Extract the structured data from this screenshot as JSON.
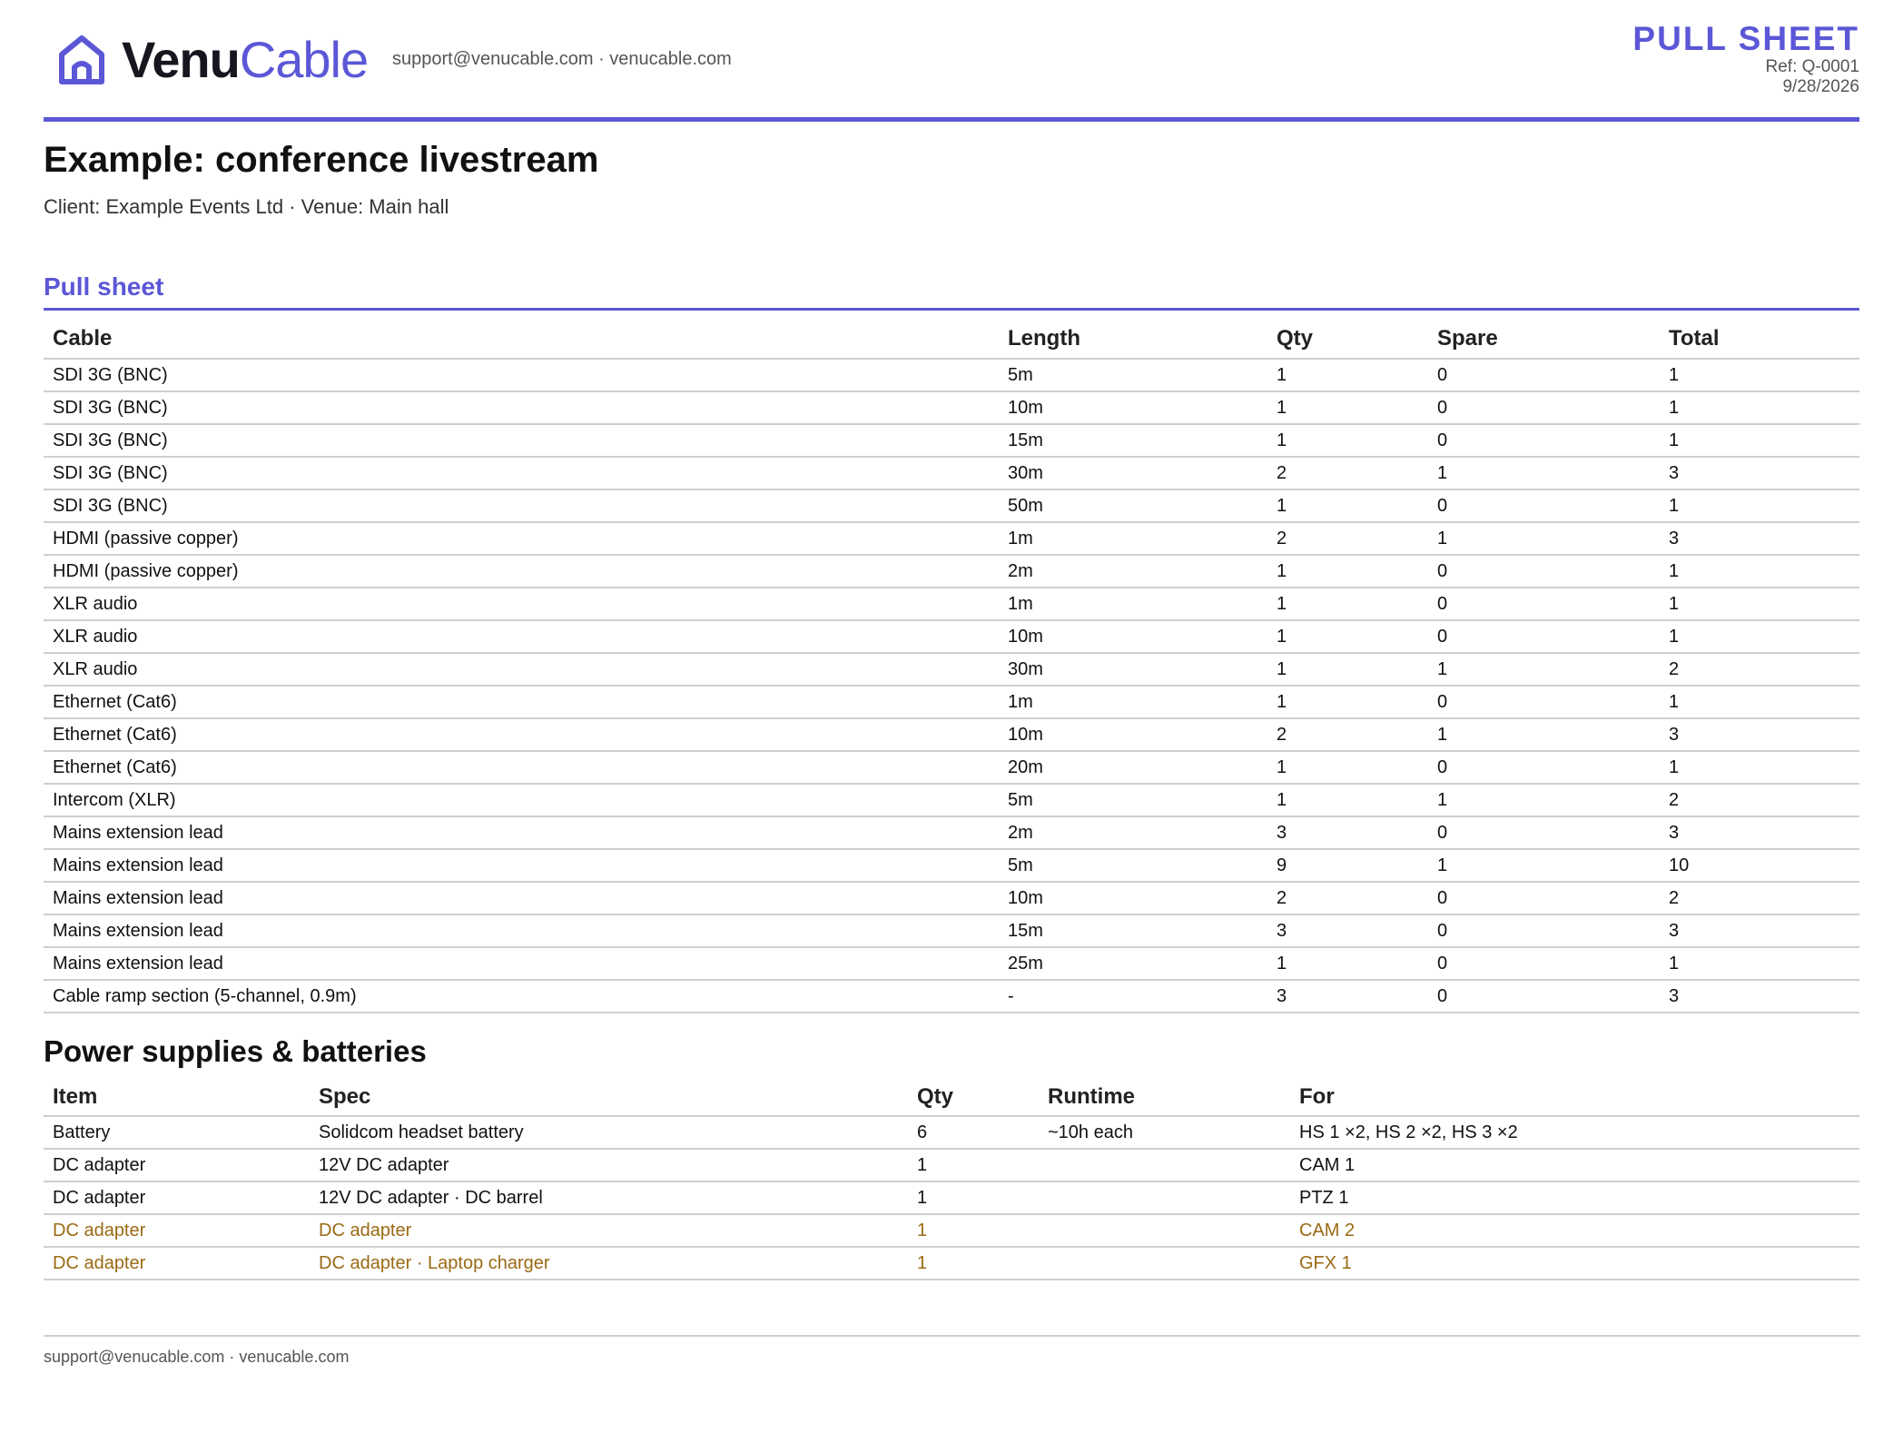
{
  "brand": {
    "name_part1": "Venu",
    "name_part2": "Cable",
    "icon": "house-icon",
    "accent": "#5b57d6"
  },
  "header": {
    "contact": "support@venucable.com · venucable.com",
    "doc_title": "PULL SHEET",
    "ref": "Ref: Q-0001",
    "date": "9/28/2026"
  },
  "project": {
    "title": "Example: conference livestream",
    "meta": "Client: Example Events Ltd · Venue: Main hall"
  },
  "pull_sheet": {
    "section_title": "Pull sheet",
    "columns": [
      "Cable",
      "Length",
      "Qty",
      "Spare",
      "Total"
    ],
    "rows": [
      [
        "SDI 3G (BNC)",
        "5m",
        "1",
        "0",
        "1"
      ],
      [
        "SDI 3G (BNC)",
        "10m",
        "1",
        "0",
        "1"
      ],
      [
        "SDI 3G (BNC)",
        "15m",
        "1",
        "0",
        "1"
      ],
      [
        "SDI 3G (BNC)",
        "30m",
        "2",
        "1",
        "3"
      ],
      [
        "SDI 3G (BNC)",
        "50m",
        "1",
        "0",
        "1"
      ],
      [
        "HDMI (passive copper)",
        "1m",
        "2",
        "1",
        "3"
      ],
      [
        "HDMI (passive copper)",
        "2m",
        "1",
        "0",
        "1"
      ],
      [
        "XLR audio",
        "1m",
        "1",
        "0",
        "1"
      ],
      [
        "XLR audio",
        "10m",
        "1",
        "0",
        "1"
      ],
      [
        "XLR audio",
        "30m",
        "1",
        "1",
        "2"
      ],
      [
        "Ethernet (Cat6)",
        "1m",
        "1",
        "0",
        "1"
      ],
      [
        "Ethernet (Cat6)",
        "10m",
        "2",
        "1",
        "3"
      ],
      [
        "Ethernet (Cat6)",
        "20m",
        "1",
        "0",
        "1"
      ],
      [
        "Intercom (XLR)",
        "5m",
        "1",
        "1",
        "2"
      ],
      [
        "Mains extension lead",
        "2m",
        "3",
        "0",
        "3"
      ],
      [
        "Mains extension lead",
        "5m",
        "9",
        "1",
        "10"
      ],
      [
        "Mains extension lead",
        "10m",
        "2",
        "0",
        "2"
      ],
      [
        "Mains extension lead",
        "15m",
        "3",
        "0",
        "3"
      ],
      [
        "Mains extension lead",
        "25m",
        "1",
        "0",
        "1"
      ],
      [
        "Cable ramp section (5-channel, 0.9m)",
        "-",
        "3",
        "0",
        "3"
      ]
    ]
  },
  "power": {
    "section_title": "Power supplies & batteries",
    "columns": [
      "Item",
      "Spec",
      "Qty",
      "Runtime",
      "For"
    ],
    "warn_color": "#9a6a14",
    "rows": [
      [
        "Battery",
        "Solidcom headset battery",
        "6",
        "~10h each",
        "HS 1 ×2, HS 2 ×2, HS 3 ×2"
      ],
      [
        "DC adapter",
        "12V DC adapter",
        "1",
        "",
        "CAM 1"
      ],
      [
        "DC adapter",
        "12V DC adapter · DC barrel",
        "1",
        "",
        "PTZ 1"
      ],
      [
        "DC adapter",
        "DC adapter",
        "1",
        "",
        "CAM 2"
      ],
      [
        "DC adapter",
        "DC adapter · Laptop charger",
        "1",
        "",
        "GFX 1"
      ]
    ],
    "warn_rows": [
      false,
      false,
      false,
      true,
      true
    ]
  },
  "footer": {
    "text": "support@venucable.com · venucable.com"
  }
}
